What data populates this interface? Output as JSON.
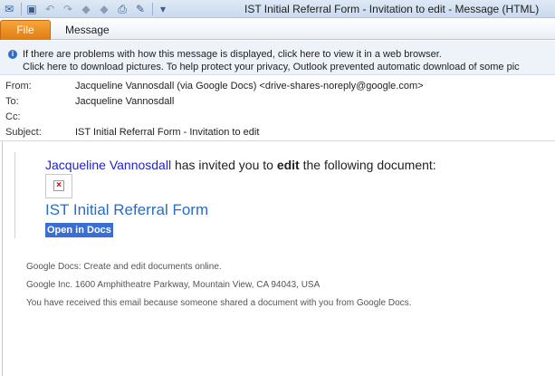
{
  "window": {
    "title": "IST Initial Referral Form - Invitation to edit  -  Message (HTML)"
  },
  "quick_access": {
    "icons": [
      "envelope-icon",
      "save-icon",
      "undo-icon",
      "redo-icon",
      "previous-item-icon",
      "next-item-icon",
      "print-icon",
      "move-icon",
      "customize-toolbar-icon"
    ]
  },
  "ribbon": {
    "file_label": "File",
    "message_label": "Message"
  },
  "infobar": {
    "line1": "If there are problems with how this message is displayed, click here to view it in a web browser.",
    "line2": "Click here to download pictures. To help protect your privacy, Outlook prevented automatic download of some pic"
  },
  "header": {
    "from_label": "From:",
    "from_value": "Jacqueline Vannosdall (via Google Docs) <drive-shares-noreply@google.com>",
    "to_label": "To:",
    "to_value": "Jacqueline Vannosdall",
    "cc_label": "Cc:",
    "cc_value": "",
    "subject_label": "Subject:",
    "subject_value": "IST Initial Referral Form - Invitation to edit"
  },
  "body": {
    "sender_name": "Jacqueline Vannosdall",
    "invite_mid": " has invited you to ",
    "invite_bold": "edit",
    "invite_end": " the following document:",
    "document_title": "IST Initial Referral Form",
    "open_button": "Open in Docs",
    "footer_line1": "Google Docs: Create and edit documents online.",
    "footer_line2": "Google Inc. 1600 Amphitheatre Parkway, Mountain View, CA 94043, USA",
    "footer_line3": "You have received this email because someone shared a document with you from Google Docs."
  },
  "colors": {
    "file_tab": "#e07c12",
    "link_blue": "#2a6cc4",
    "sender_blue": "#2222cc",
    "open_button_bg": "#3a6fd1"
  }
}
